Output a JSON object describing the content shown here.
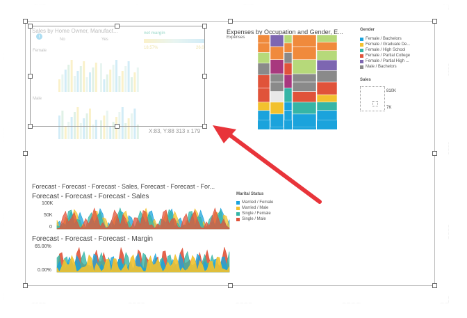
{
  "faded_visual": {
    "title": "Sales by Home Owner, Manufact...",
    "info_icon": "info-icon",
    "col_no": "No",
    "col_yes": "Yes",
    "row_female": "Female",
    "row_male": "Male",
    "legend_title": "net margin",
    "legend_min": "18.57%",
    "legend_max": "26.0",
    "position_readout": "X:83, Y:88 313 x 179"
  },
  "mosaic": {
    "title": "Expenses by Occupation and Gender, E...",
    "subtitle": "Expenses",
    "gender_legend_title": "Gender",
    "gender_legend": [
      {
        "label": "Female / Bachelors",
        "color": "#1ba3dc"
      },
      {
        "label": "Female / Graduate De...",
        "color": "#f2c12e"
      },
      {
        "label": "Female / High School",
        "color": "#36b5a6"
      },
      {
        "label": "Female / Partial College",
        "color": "#e0533a"
      },
      {
        "label": "Female / Partial High ...",
        "color": "#7d66b1"
      },
      {
        "label": "Male / Bachelors",
        "color": "#8a8a8a"
      }
    ],
    "sales_legend_title": "Sales",
    "sales_max": "810K",
    "sales_min": "7K"
  },
  "forecast": {
    "header": "Forecast - Forecast - Forecast - Sales, Forecast - Forecast - For...",
    "sales_title": "Forecast - Forecast - Forecast - Sales",
    "sales_ticks": [
      "100K",
      "50K",
      "0"
    ],
    "margin_title": "Forecast - Forecast - Forecast - Margin",
    "margin_ticks": [
      "65.00%",
      "0.00%"
    ],
    "legend_title": "Marital Status",
    "legend": [
      {
        "label": "Married / Female",
        "color": "#1ba3dc"
      },
      {
        "label": "Married / Male",
        "color": "#f2c12e"
      },
      {
        "label": "Single / Female",
        "color": "#36b5a6"
      },
      {
        "label": "Single / Male",
        "color": "#e0533a"
      }
    ]
  },
  "annotation": {
    "arrow_color": "#e8343a"
  }
}
